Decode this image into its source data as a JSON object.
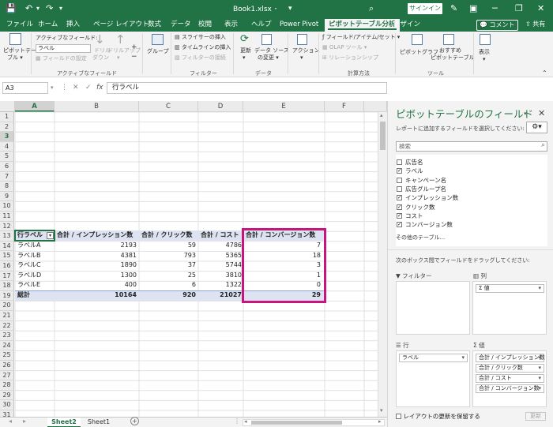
{
  "window": {
    "title": "Book1.xlsx ･ ",
    "signin": "サインイン",
    "minimize": "─",
    "restore": "❐",
    "close": "✕",
    "customize": "▾"
  },
  "tabs": [
    "ファイル",
    "ホーム",
    "挿入",
    "ページ レイアウト",
    "数式",
    "データ",
    "校閲",
    "表示",
    "ヘルプ",
    "Power Pivot",
    "ピボットテーブル分析",
    "デザイン"
  ],
  "tabs_right": {
    "comment": "コメント",
    "share": "共有"
  },
  "ribbon": {
    "pivot_label_1": "ピボットテー",
    "pivot_label_2": "ブル ▾",
    "active_field_label": "アクティブなフィールド:",
    "active_field_value": "ラベル",
    "field_settings": "フィールドの設定",
    "drilldown_1": "ドリル",
    "drilldown_2": "ダウン",
    "drillup_1": "ドリルアップ",
    "drillup_2": "▾",
    "group_active_field": "アクティブなフィールド",
    "group_btn": "グループ",
    "slicer": "スライサーの挿入",
    "timeline": "タイムラインの挿入",
    "filter_conn": "フィルターの接続",
    "group_filter": "フィルター",
    "refresh_1": "更新",
    "refresh_2": "▾",
    "datasource_1": "データ ソース",
    "datasource_2": "の変更 ▾",
    "group_data": "データ",
    "action": "アクション",
    "fields_items": "フィールド/アイテム/セット ▾",
    "olap": "OLAP ツール ▾",
    "relationships": "リレーションシップ",
    "group_calc": "計算方法",
    "pivotchart": "ピボットグラフ",
    "recommended_1": "おすすめ",
    "recommended_2": "ピボットテーブル",
    "group_tools": "ツール",
    "show": "表示"
  },
  "formula_bar": {
    "name_box": "A3",
    "value": "行ラベル"
  },
  "columns": [
    "A",
    "B",
    "C",
    "D",
    "E",
    "F"
  ],
  "rows": [
    "1",
    "2",
    "3",
    "4",
    "5",
    "6",
    "7",
    "8",
    "9",
    "10",
    "11",
    "12",
    "13",
    "14",
    "15",
    "16",
    "17",
    "18",
    "19",
    "20",
    "21",
    "22",
    "23",
    "24",
    "25",
    "26",
    "27",
    "28",
    "29",
    "30",
    "31"
  ],
  "pivot": {
    "headers": [
      "行ラベル",
      "合計 / インプレッション数",
      "合計 / クリック数",
      "合計 / コスト",
      "合計 / コンバージョン数"
    ],
    "filter_glyph": "▾",
    "rows": [
      [
        "ラベルA",
        "2193",
        "59",
        "4786",
        "7"
      ],
      [
        "ラベルB",
        "4381",
        "793",
        "5365",
        "18"
      ],
      [
        "ラベルC",
        "1890",
        "37",
        "5744",
        "3"
      ],
      [
        "ラベルD",
        "1300",
        "25",
        "3810",
        "1"
      ],
      [
        "ラベルE",
        "400",
        "6",
        "1322",
        "0"
      ]
    ],
    "total": [
      "総計",
      "10164",
      "920",
      "21027",
      "29"
    ]
  },
  "sheets": [
    "Sheet2",
    "Sheet1"
  ],
  "pane": {
    "title": "ピボットテーブルのフィールド",
    "subtitle": "レポートに追加するフィールドを選択してください:",
    "close": "✕",
    "search_placeholder": "検索",
    "fields": [
      {
        "label": "広告名",
        "checked": false
      },
      {
        "label": "ラベル",
        "checked": true
      },
      {
        "label": "キャンペーン名",
        "checked": false
      },
      {
        "label": "広告グループ名",
        "checked": false
      },
      {
        "label": "インプレッション数",
        "checked": true
      },
      {
        "label": "クリック数",
        "checked": true
      },
      {
        "label": "コスト",
        "checked": true
      },
      {
        "label": "コンバージョン数",
        "checked": true
      }
    ],
    "more_tables": "その他のテーブル...",
    "drag_hint": "次のボックス間でフィールドをドラッグしてください:",
    "filter_area": "フィルター",
    "columns_area": "列",
    "rows_area": "行",
    "values_area": "値",
    "columns_chip": "Σ 値",
    "rows_chip": "ラベル",
    "value_chips": [
      "合計 / インプレッション数",
      "合計 / クリック数",
      "合計 / コスト",
      "合計 / コンバージョン数"
    ],
    "defer_label": "レイアウトの更新を保留する",
    "update_button": "更新"
  },
  "colors": {
    "excel_green": "#217346",
    "highlight": "#c8157e",
    "pivot_band": "#dde3f1"
  }
}
